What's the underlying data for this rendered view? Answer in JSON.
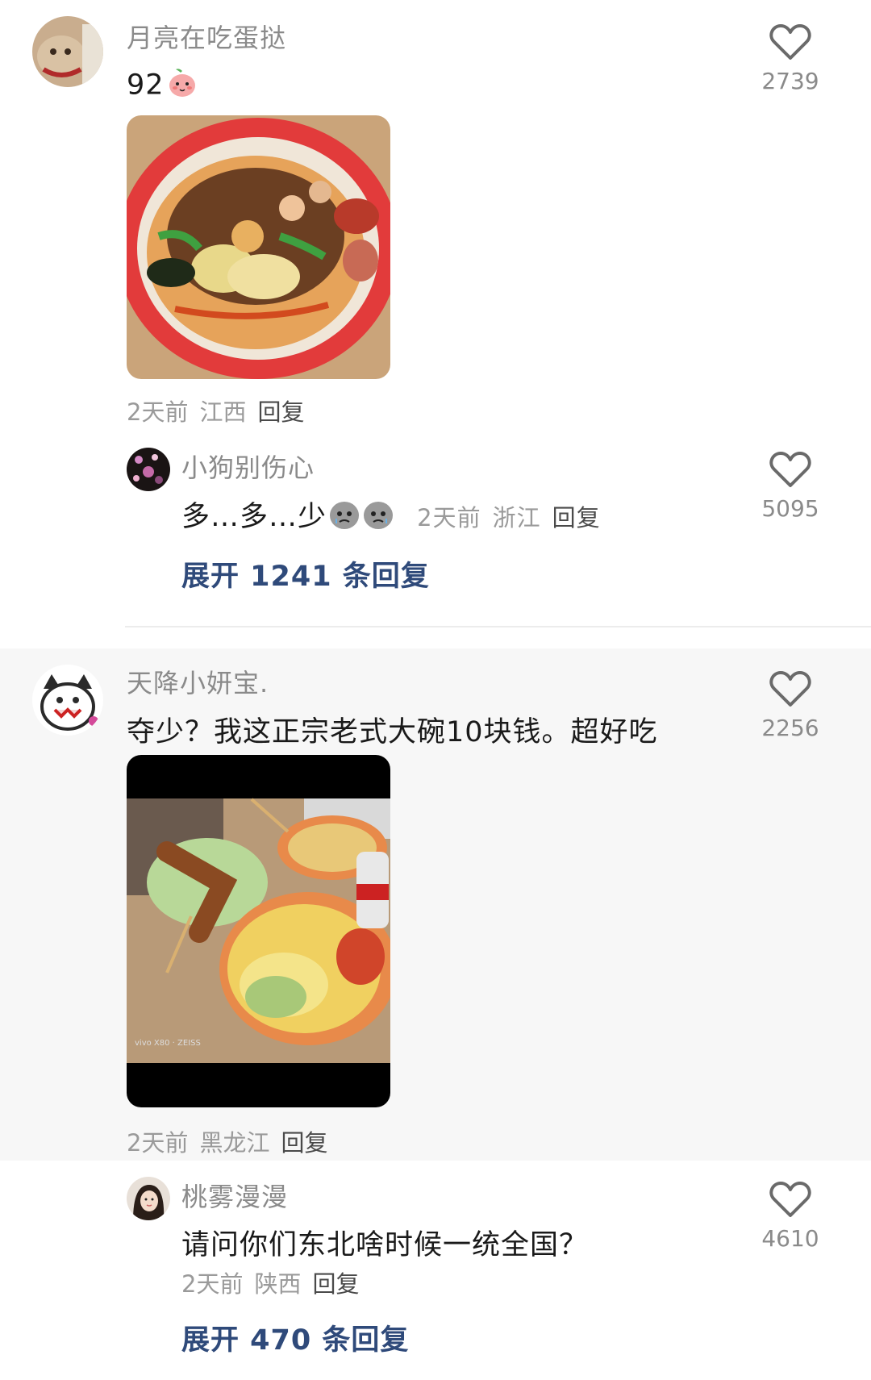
{
  "comments": [
    {
      "username": "月亮在吃蛋挞",
      "text": "92",
      "like_count": "2739",
      "time": "2天前",
      "location": "江西",
      "reply_label": "回复",
      "emoji": "smiling-peach-emoji"
    },
    {
      "username": "小狗别伤心",
      "text": "多…多…少",
      "like_count": "5095",
      "time": "2天前",
      "location": "浙江",
      "reply_label": "回复",
      "emoji": "crying-face-emoji"
    },
    {
      "username": "天降小妍宝.",
      "text": "夺少？我这正宗老式大碗10块钱。超好吃",
      "like_count": "2256",
      "time": "2天前",
      "location": "黑龙江",
      "reply_label": "回复"
    },
    {
      "username": "桃雾漫漫",
      "text": "请问你们东北啥时候一统全国？",
      "like_count": "4610",
      "time": "2天前",
      "location": "陕西",
      "reply_label": "回复"
    }
  ],
  "expand_replies": [
    {
      "label": "展开 1241 条回复"
    },
    {
      "label": "展开 470 条回复"
    }
  ],
  "photo_watermark": "vivo X80 · ZEISS",
  "colors": {
    "username": "#8a8a8a",
    "expand_link": "#2f4a7a",
    "highlight_bg": "#f7f7f7"
  }
}
